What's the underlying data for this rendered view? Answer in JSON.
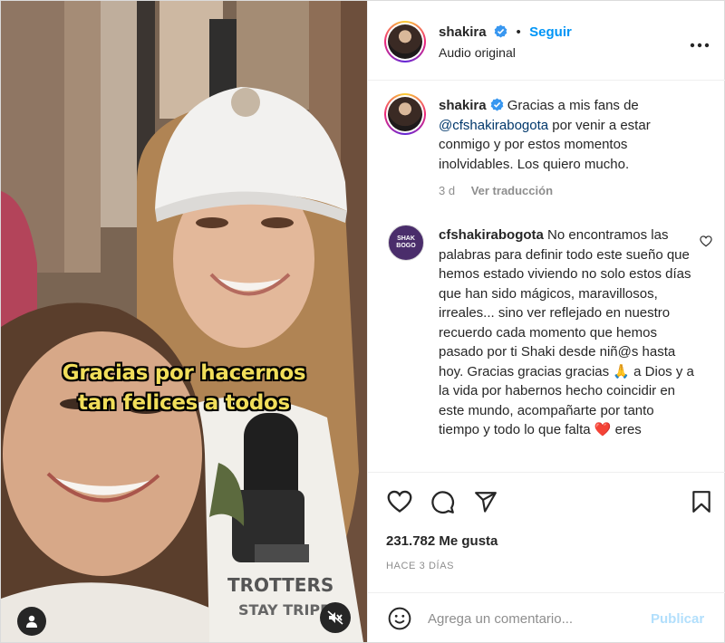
{
  "post": {
    "author": {
      "username": "shakira",
      "verified": true,
      "follow_label": "Seguir",
      "subtitle": "Audio original"
    },
    "media": {
      "overlay_line1": "Gracias por hacernos",
      "overlay_line2": "tan felices a todos",
      "controls": [
        "user-tag-icon",
        "muted-speaker-icon"
      ]
    },
    "more_icon": "more-horizontal-icon",
    "caption": {
      "username": "shakira",
      "text_before": " Gracias a mis fans de ",
      "mention": "@cfshakirabogota",
      "text_after": " por venir a estar conmigo y por estos momentos inolvidables. Los quiero mucho.",
      "time": "3 d",
      "translate": "Ver traducción"
    },
    "comments": [
      {
        "username": "cfshakirabogota",
        "avatar_label": "SHAK BOGO",
        "text": " No encontramos las palabras para definir todo este sueño que hemos estado viviendo no solo estos días que han sido mágicos, maravillosos, irreales... sino ver reflejado en nuestro recuerdo cada momento que hemos pasado por ti Shaki desde niñ@s hasta hoy. Gracias gracias gracias 🙏 a Dios y a la vida por habernos hecho coincidir en este mundo, acompañarte por tanto tiempo y todo lo que falta ❤️ eres",
        "like_icon": "heart-outline-icon"
      }
    ],
    "actions": {
      "icons": [
        "heart-outline-icon",
        "comment-icon",
        "share-icon",
        "bookmark-icon"
      ]
    },
    "likes": "231.782 Me gusta",
    "time_ago": "HACE 3 DÍAS",
    "add_comment": {
      "placeholder": "Agrega un comentario...",
      "emoji_icon": "emoji-icon",
      "publish_label": "Publicar"
    },
    "colors": {
      "accent_blue": "#0095f6",
      "publish_disabled": "#b2dffc",
      "overlay_text": "#f1de5a",
      "secondary_text": "#8e8e8e"
    }
  }
}
